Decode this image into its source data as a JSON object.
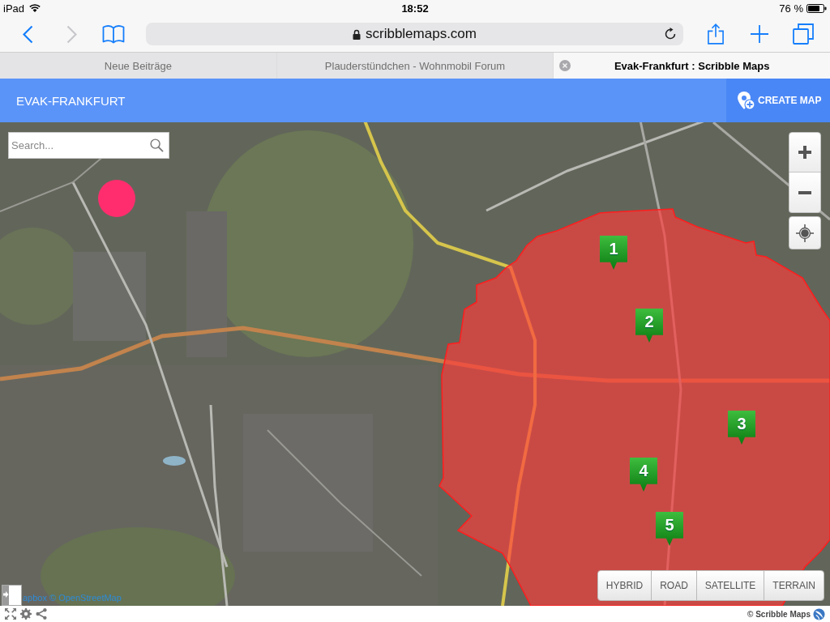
{
  "status_bar": {
    "device": "iPad",
    "time": "18:52",
    "battery": "76 %"
  },
  "browser": {
    "nav_buttons": [
      {
        "kind": "back",
        "disabled": false
      },
      {
        "kind": "forward",
        "disabled": true
      }
    ],
    "address": "scribblemaps.com",
    "tabs": [
      {
        "title": "Neue Beiträge",
        "selected": false
      },
      {
        "title": "Plauderstündchen - Wohnmobil Forum",
        "selected": false
      },
      {
        "title": "Evak-Frankfurt : Scribble Maps",
        "selected": true
      }
    ]
  },
  "app_header": {
    "title": "EVAK-FRANKFURT",
    "create_button": "CREATE MAP"
  },
  "map": {
    "search": {
      "placeholder": "Search..."
    },
    "markers": [
      "1",
      "2",
      "3",
      "4",
      "5"
    ],
    "map_types": [
      "HYBRID",
      "ROAD",
      "SATELLITE",
      "TERRAIN"
    ],
    "attribution": "apbox © OpenStreetMap"
  },
  "footer": {
    "credit": "© Scribble Maps"
  }
}
